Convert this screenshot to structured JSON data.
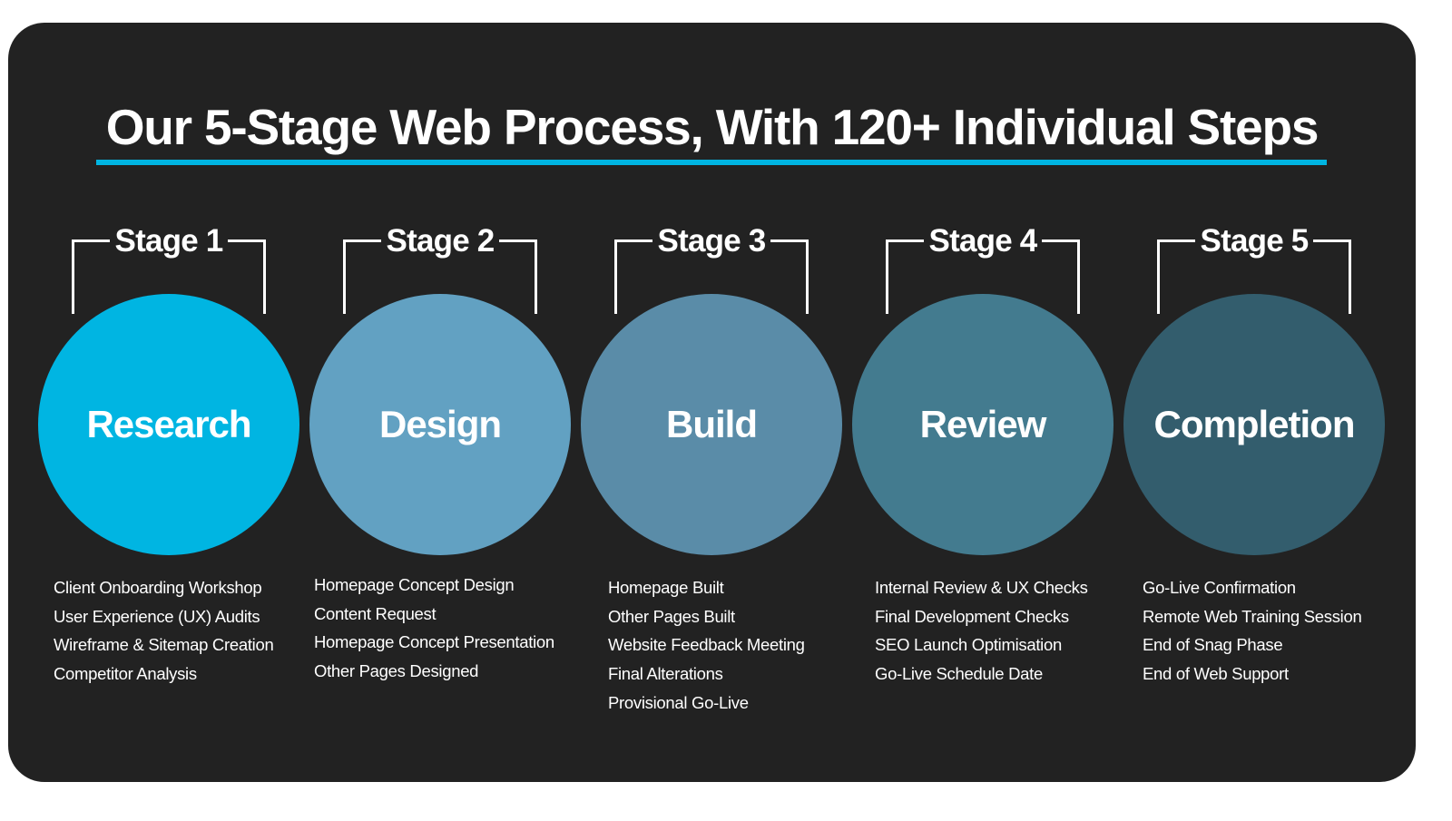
{
  "title": "Our 5-Stage Web Process, With 120+ Individual Steps",
  "colors": {
    "background": "#222222",
    "accent": "#00b5e2",
    "text": "#ffffff"
  },
  "stages": [
    {
      "label": "Stage 1",
      "name": "Research",
      "color": "#00b5e2",
      "steps": [
        "Client Onboarding Workshop",
        "User Experience (UX) Audits",
        "Wireframe & Sitemap Creation",
        "Competitor Analysis"
      ]
    },
    {
      "label": "Stage 2",
      "name": "Design",
      "color": "#62a1c2",
      "steps": [
        "Homepage Concept Design",
        "Content Request",
        "Homepage Concept Presentation",
        "Other Pages Designed"
      ]
    },
    {
      "label": "Stage 3",
      "name": "Build",
      "color": "#5a8ca8",
      "steps": [
        "Homepage Built",
        "Other Pages Built",
        "Website Feedback Meeting",
        "Final Alterations",
        "Provisional Go-Live"
      ]
    },
    {
      "label": "Stage 4",
      "name": "Review",
      "color": "#437b8f",
      "steps": [
        "Internal Review & UX Checks",
        "Final Development Checks",
        "SEO Launch Optimisation",
        "Go-Live Schedule Date"
      ]
    },
    {
      "label": "Stage 5",
      "name": "Completion",
      "color": "#335d6d",
      "steps": [
        "Go-Live Confirmation",
        "Remote Web Training Session",
        "End of Snag Phase",
        "End of Web Support"
      ]
    }
  ]
}
